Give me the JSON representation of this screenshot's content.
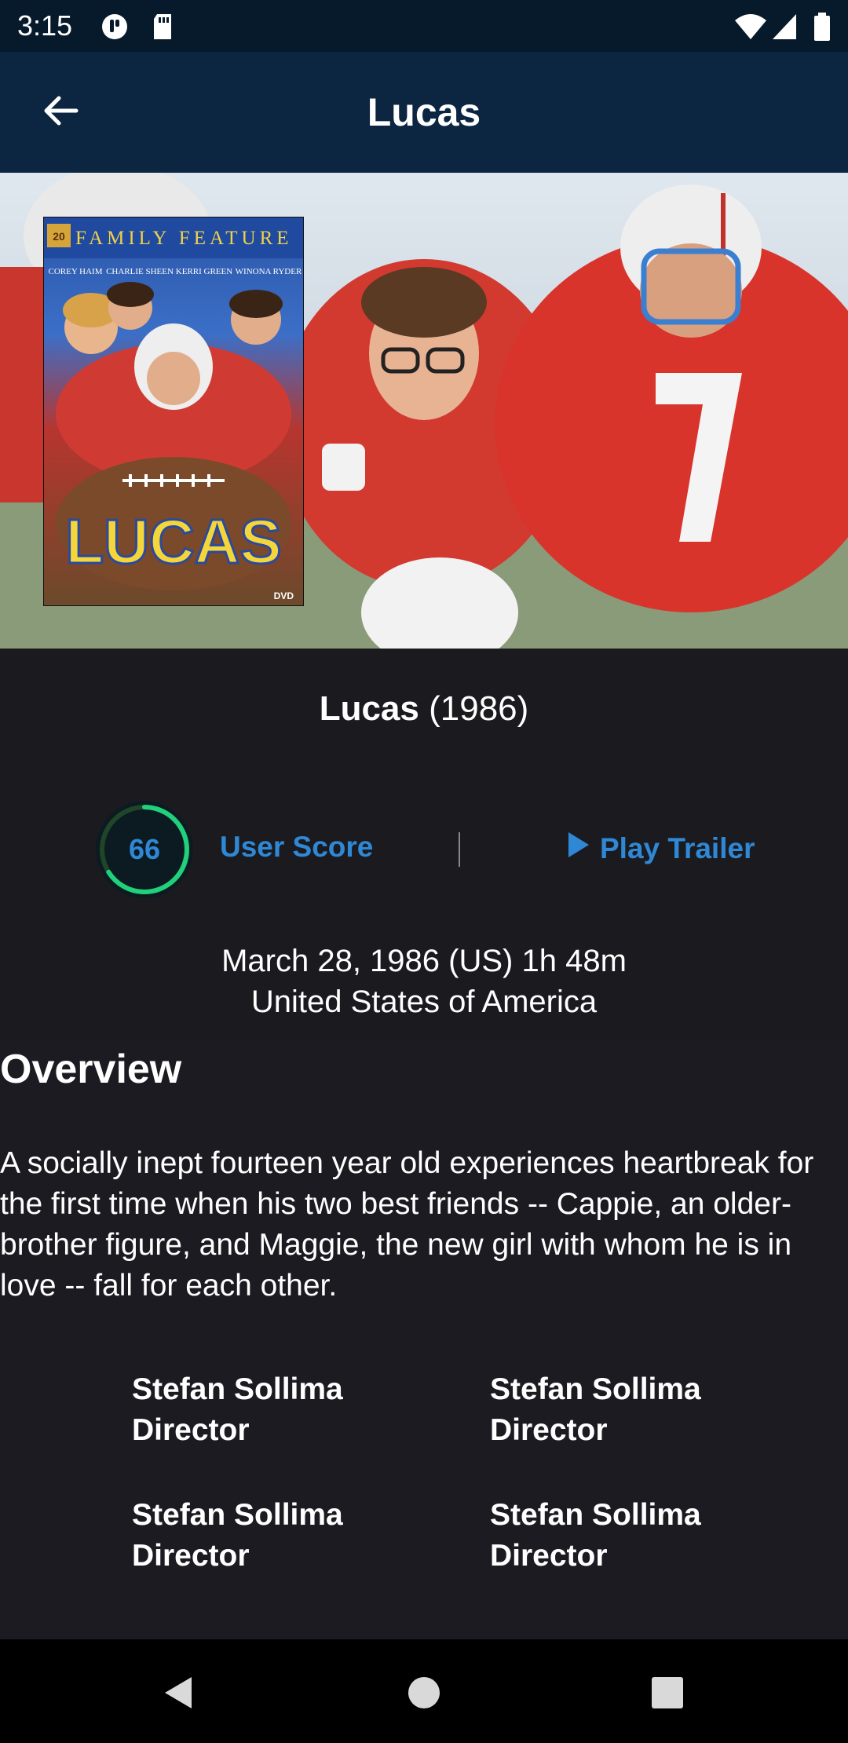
{
  "status_bar": {
    "time": "3:15",
    "left_icons": [
      "circle-badge-icon",
      "sd-card-icon"
    ],
    "right_icons": [
      "wifi-icon",
      "signal-icon",
      "battery-icon"
    ]
  },
  "app_bar": {
    "title": "Lucas",
    "back_icon": "arrow-left-icon"
  },
  "poster": {
    "banner": "FAMILY FEATURE",
    "studio": "20",
    "cast": [
      "COREY HAIM",
      "CHARLIE SHEEN",
      "KERRI GREEN",
      "WINONA RYDER"
    ],
    "logo": "LUCAS",
    "format": "DVD"
  },
  "movie": {
    "title": "Lucas",
    "year": "(1986)"
  },
  "score": {
    "value": "66",
    "percent": 66,
    "label": "User Score",
    "ring_color": "#21d07a",
    "track_color": "#204529"
  },
  "trailer": {
    "label": "Play Trailer",
    "icon": "play-icon"
  },
  "release": {
    "line1": "March 28, 1986 (US) 1h 48m",
    "line2": "United States of America"
  },
  "overview": {
    "heading": "Overview",
    "text": "A socially inept fourteen year old experiences heartbreak for the first time when his two best friends -- Cappie, an older-brother figure, and Maggie, the new girl with whom he is in love -- fall for each other."
  },
  "crew": [
    {
      "name": "Stefan Sollima",
      "job": "Director"
    },
    {
      "name": "Stefan Sollima",
      "job": "Director"
    },
    {
      "name": "Stefan Sollima",
      "job": "Director"
    },
    {
      "name": "Stefan Sollima",
      "job": "Director"
    }
  ],
  "nav": {
    "back": "nav-back-icon",
    "home": "nav-home-icon",
    "recents": "nav-recents-icon"
  },
  "colors": {
    "accent": "#2f88d6",
    "app_bar": "#0c2540",
    "background": "#1c1b22"
  }
}
